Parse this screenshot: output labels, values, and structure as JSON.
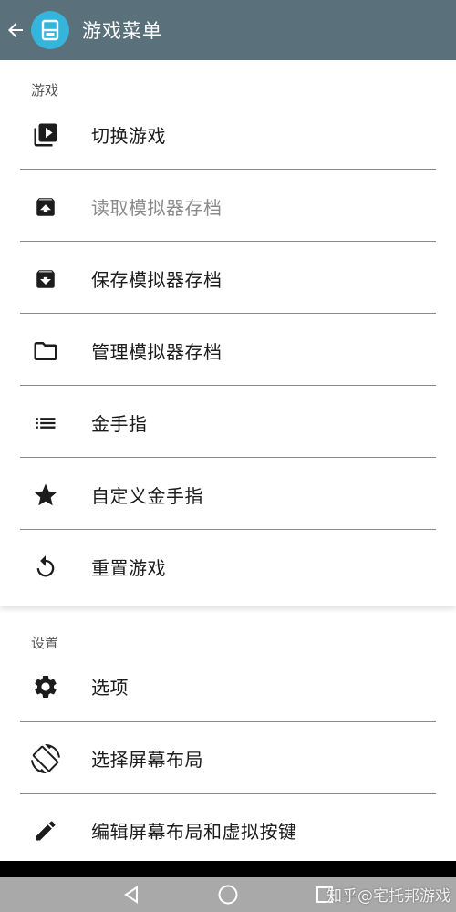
{
  "appbar": {
    "title": "游戏菜单",
    "back_icon": "arrow-back-icon",
    "logo_icon": "console-logo-icon",
    "logo_color": "#35b4dc",
    "background": "#5a707b"
  },
  "games_section": {
    "header": "游戏",
    "items": [
      {
        "label": "切换游戏",
        "icon": "switch-game-icon",
        "disabled": false
      },
      {
        "label": "读取模拟器存档",
        "icon": "load-state-icon",
        "disabled": true
      },
      {
        "label": "保存模拟器存档",
        "icon": "save-state-icon",
        "disabled": false
      },
      {
        "label": "管理模拟器存档",
        "icon": "folder-icon",
        "disabled": false
      },
      {
        "label": "金手指",
        "icon": "list-icon",
        "disabled": false
      },
      {
        "label": "自定义金手指",
        "icon": "star-icon",
        "disabled": false
      },
      {
        "label": "重置游戏",
        "icon": "reset-icon",
        "disabled": false
      }
    ]
  },
  "settings_section": {
    "header": "设置",
    "items": [
      {
        "label": "选项",
        "icon": "gear-icon"
      },
      {
        "label": "选择屏幕布局",
        "icon": "screen-rotation-icon"
      },
      {
        "label": "编辑屏幕布局和虚拟按键",
        "icon": "pencil-icon"
      }
    ]
  },
  "navbar": {
    "back_icon": "nav-back-icon",
    "home_icon": "nav-home-icon",
    "recents_icon": "nav-recents-icon"
  },
  "watermark": "知乎@宅托邦游戏"
}
